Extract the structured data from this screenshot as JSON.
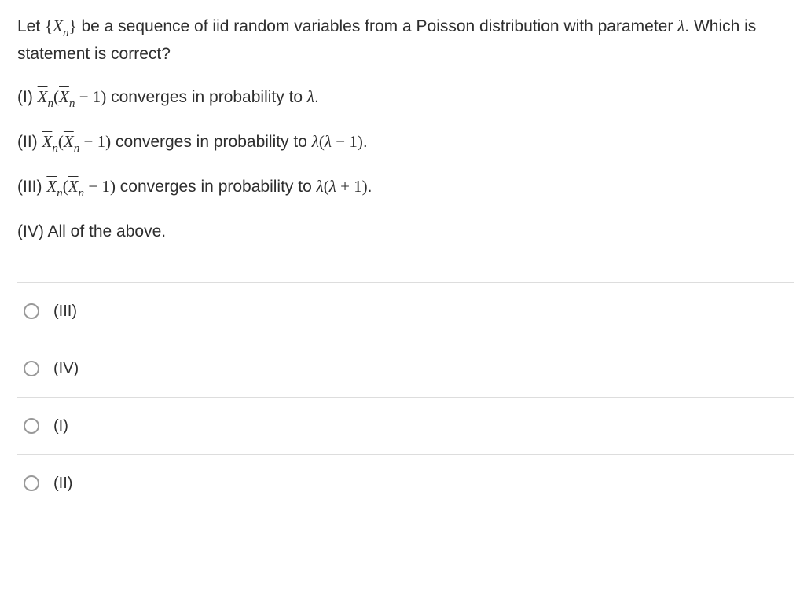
{
  "question": {
    "intro_part1": "Let ",
    "intro_part2": " be a sequence of iid random variables from a Poisson distribution with parameter ",
    "intro_part3": ". Which is statement is correct?"
  },
  "statements": {
    "s1": {
      "roman": "(I) ",
      "converges": " converges in probability to ",
      "end": "."
    },
    "s2": {
      "roman": "(II)  ",
      "converges": " converges in probability to ",
      "end": "."
    },
    "s3": {
      "roman": "(III)  ",
      "converges": " converges in probability to ",
      "end": "."
    },
    "s4": {
      "text": "(IV) All of the above."
    }
  },
  "options": [
    {
      "label": "(III)"
    },
    {
      "label": "(IV)"
    },
    {
      "label": "(I)"
    },
    {
      "label": "(II)"
    }
  ]
}
